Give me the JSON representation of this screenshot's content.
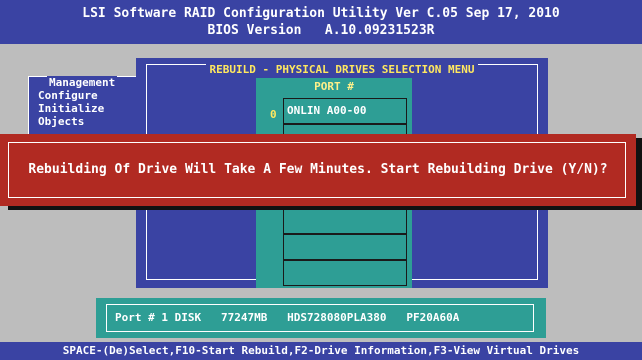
{
  "header": {
    "line1": "LSI Software RAID Configuration Utility Ver C.05 Sep 17, 2010",
    "line2": "BIOS Version   A.10.09231523R"
  },
  "left_menu": {
    "title": "Management",
    "items": [
      "Configure",
      "Initialize",
      "Objects"
    ]
  },
  "main_window": {
    "title": "REBUILD - PHYSICAL DRIVES SELECTION MENU"
  },
  "port_list": {
    "header": "PORT #",
    "index": "0",
    "rows": [
      "ONLIN A00-00",
      "",
      "",
      "",
      "",
      "",
      ""
    ]
  },
  "dialog": {
    "message": "Rebuilding Of Drive Will Take A Few Minutes. Start Rebuilding Drive (Y/N)?"
  },
  "info_bar": {
    "text": "Port # 1 DISK   77247MB   HDS728080PLA380   PF20A60A"
  },
  "footer": {
    "text": "SPACE-(De)Select,F10-Start Rebuild,F2-Drive Information,F3-View Virtual Drives"
  }
}
